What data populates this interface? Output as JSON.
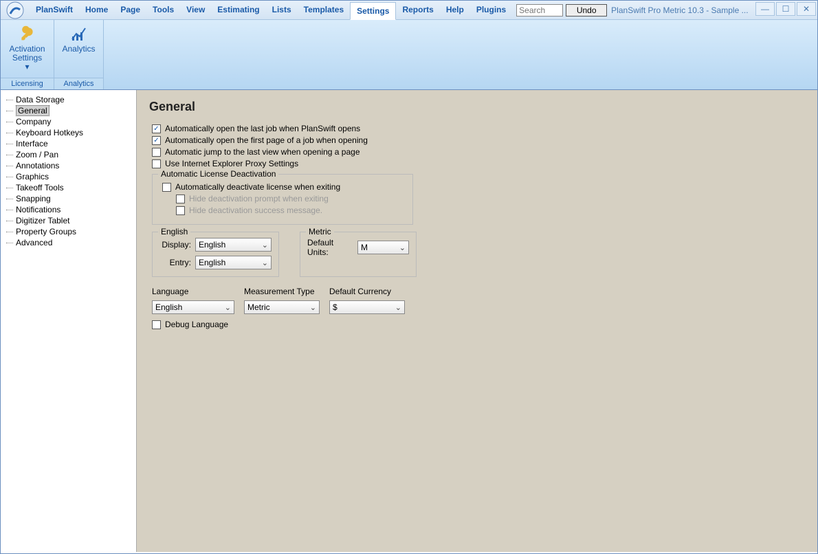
{
  "title": "PlanSwift Pro Metric 10.3 - Sample ...",
  "menu": {
    "items": [
      "PlanSwift",
      "Home",
      "Page",
      "Tools",
      "View",
      "Estimating",
      "Lists",
      "Templates",
      "Settings",
      "Reports",
      "Help",
      "Plugins"
    ],
    "active": "Settings"
  },
  "search": {
    "placeholder": "Search"
  },
  "undo_label": "Undo",
  "ribbon": {
    "activation": {
      "label": "Activation\nSettings ▾",
      "footer": "Licensing"
    },
    "analytics": {
      "label": "Analytics",
      "footer": "Analytics"
    }
  },
  "tree": [
    "Data Storage",
    "General",
    "Company",
    "Keyboard Hotkeys",
    "Interface",
    "Zoom / Pan",
    "Annotations",
    "Graphics",
    "Takeoff Tools",
    "Snapping",
    "Notifications",
    "Digitizer Tablet",
    "Property Groups",
    "Advanced"
  ],
  "tree_selected": "General",
  "panel": {
    "heading": "General",
    "chk1": "Automatically open the last job when PlanSwift opens",
    "chk2": "Automatically open the first page of a job when opening",
    "chk3": "Automatic jump to the last view when opening a page",
    "chk4": "Use Internet Explorer Proxy Settings",
    "grp1_title": "Automatic License Deactivation",
    "grp1_a": "Automatically deactivate license when exiting",
    "grp1_b": "Hide deactivation prompt when exiting",
    "grp1_c": "Hide deactivation success message.",
    "english_title": "English",
    "display_lbl": "Display:",
    "display_val": "English",
    "entry_lbl": "Entry:",
    "entry_val": "English",
    "metric_title": "Metric",
    "defunits_lbl": "Default Units:",
    "defunits_val": "M",
    "language_lbl": "Language",
    "language_val": "English",
    "mtype_lbl": "Measurement Type",
    "mtype_val": "Metric",
    "curr_lbl": "Default Currency",
    "curr_val": "$",
    "debug_lbl": "Debug Language"
  }
}
